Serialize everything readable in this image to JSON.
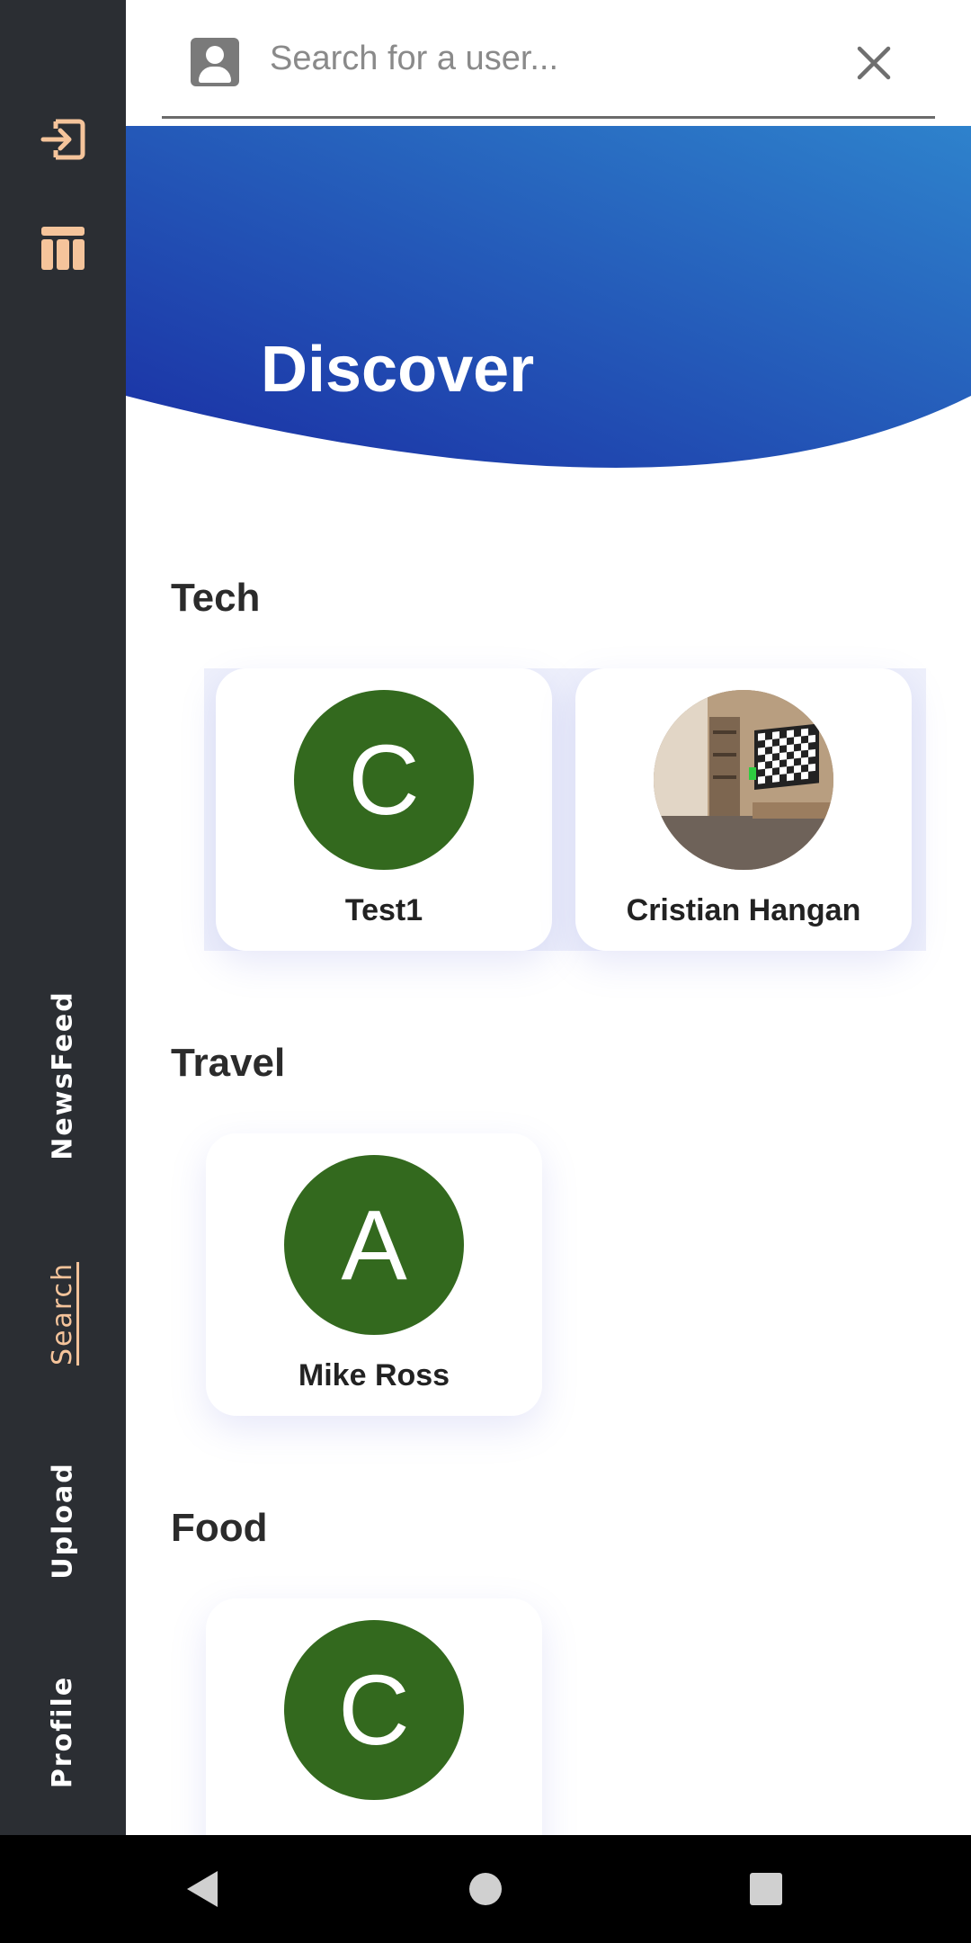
{
  "sidebar": {
    "top_icons": [
      {
        "name": "login-icon",
        "color": "#f5c49b"
      },
      {
        "name": "grid-icon",
        "color": "#f5c49b"
      }
    ],
    "nav_items": [
      {
        "label": "NewsFeed",
        "active": false
      },
      {
        "label": "Search",
        "active": true
      },
      {
        "label": "Upload",
        "active": false
      },
      {
        "label": "Profile",
        "active": false
      }
    ],
    "active_color": "#f5c49b",
    "background": "#2b2e33"
  },
  "search": {
    "placeholder": "Search for a user...",
    "value": ""
  },
  "header": {
    "title": "Discover",
    "gradient_colors": [
      "#1a2fa4",
      "#2e82cc"
    ]
  },
  "sections": [
    {
      "title": "Tech",
      "users": [
        {
          "name": "Test1",
          "initial": "C",
          "has_photo": false
        },
        {
          "name": "Cristian Hangan",
          "initial": "",
          "has_photo": true
        }
      ]
    },
    {
      "title": "Travel",
      "users": [
        {
          "name": "Mike Ross",
          "initial": "A",
          "has_photo": false
        }
      ]
    },
    {
      "title": "Food",
      "users": [
        {
          "name": "",
          "initial": "C",
          "has_photo": false
        }
      ]
    }
  ],
  "avatar_color": "#33691e",
  "system_nav": [
    "back-icon",
    "home-icon",
    "recents-icon"
  ]
}
